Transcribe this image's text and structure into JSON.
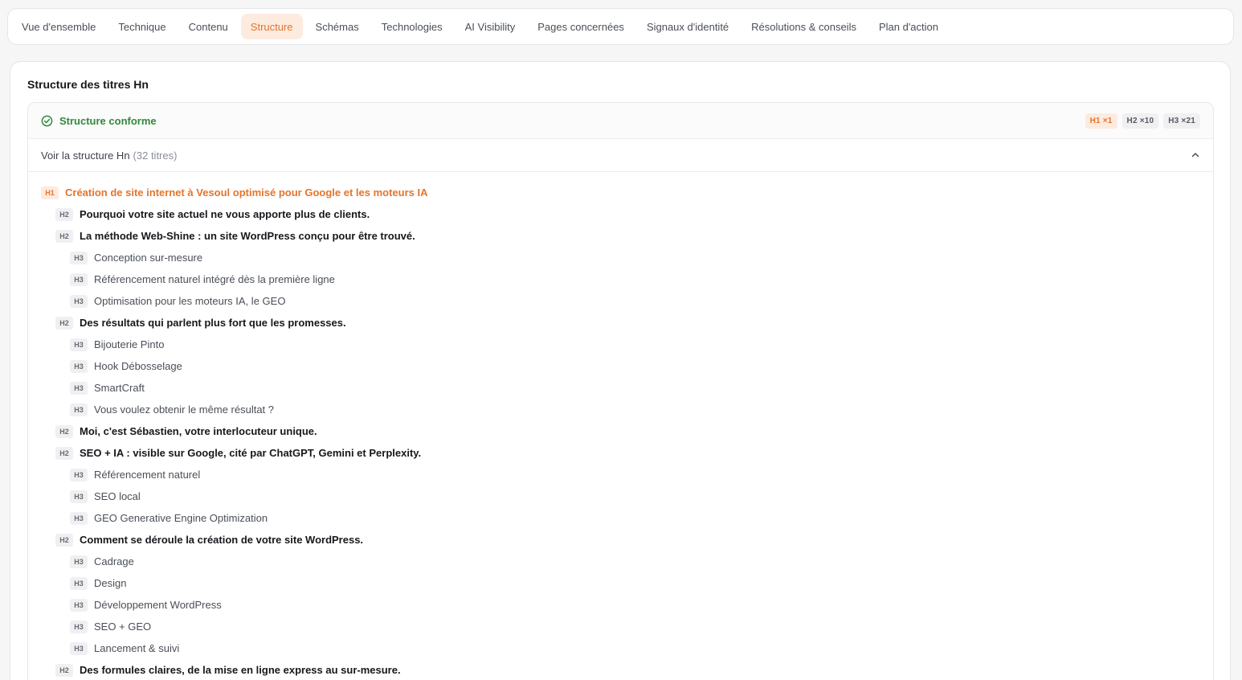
{
  "tabs": [
    {
      "label": "Vue d'ensemble",
      "active": false
    },
    {
      "label": "Technique",
      "active": false
    },
    {
      "label": "Contenu",
      "active": false
    },
    {
      "label": "Structure",
      "active": true
    },
    {
      "label": "Schémas",
      "active": false
    },
    {
      "label": "Technologies",
      "active": false
    },
    {
      "label": "AI Visibility",
      "active": false
    },
    {
      "label": "Pages concernées",
      "active": false
    },
    {
      "label": "Signaux d'identité",
      "active": false
    },
    {
      "label": "Résolutions & conseils",
      "active": false
    },
    {
      "label": "Plan d'action",
      "active": false
    }
  ],
  "card": {
    "title": "Structure des titres Hn",
    "status": {
      "label": "Structure conforme",
      "icon": "check-circle-icon",
      "color": "#2f8a3b"
    },
    "counts": [
      {
        "label": "H1 ×1",
        "level": "h1"
      },
      {
        "label": "H2 ×10",
        "level": "h2"
      },
      {
        "label": "H3 ×21",
        "level": "h3"
      }
    ],
    "toggle": {
      "label": "Voir la structure Hn",
      "count": "(32 titres)",
      "icon": "chevron-up-icon"
    },
    "headings": [
      {
        "level": 1,
        "tag": "H1",
        "text": "Création de site internet à Vesoul optimisé pour Google et les moteurs IA"
      },
      {
        "level": 2,
        "tag": "H2",
        "text": "Pourquoi votre site actuel ne vous apporte plus de clients."
      },
      {
        "level": 2,
        "tag": "H2",
        "text": "La méthode Web-Shine : un site WordPress conçu pour être trouvé."
      },
      {
        "level": 3,
        "tag": "H3",
        "text": "Conception sur-mesure"
      },
      {
        "level": 3,
        "tag": "H3",
        "text": "Référencement naturel intégré dès la première ligne"
      },
      {
        "level": 3,
        "tag": "H3",
        "text": "Optimisation pour les moteurs IA, le GEO"
      },
      {
        "level": 2,
        "tag": "H2",
        "text": "Des résultats qui parlent plus fort que les promesses."
      },
      {
        "level": 3,
        "tag": "H3",
        "text": "Bijouterie Pinto"
      },
      {
        "level": 3,
        "tag": "H3",
        "text": "Hook Débosselage"
      },
      {
        "level": 3,
        "tag": "H3",
        "text": "SmartCraft"
      },
      {
        "level": 3,
        "tag": "H3",
        "text": "Vous voulez obtenir le même résultat ?"
      },
      {
        "level": 2,
        "tag": "H2",
        "text": "Moi, c'est Sébastien, votre interlocuteur unique."
      },
      {
        "level": 2,
        "tag": "H2",
        "text": "SEO + IA : visible sur Google, cité par ChatGPT, Gemini et Perplexity."
      },
      {
        "level": 3,
        "tag": "H3",
        "text": "Référencement naturel"
      },
      {
        "level": 3,
        "tag": "H3",
        "text": "SEO local"
      },
      {
        "level": 3,
        "tag": "H3",
        "text": "GEO Generative Engine Optimization"
      },
      {
        "level": 2,
        "tag": "H2",
        "text": "Comment se déroule la création de votre site WordPress."
      },
      {
        "level": 3,
        "tag": "H3",
        "text": "Cadrage"
      },
      {
        "level": 3,
        "tag": "H3",
        "text": "Design"
      },
      {
        "level": 3,
        "tag": "H3",
        "text": "Développement WordPress"
      },
      {
        "level": 3,
        "tag": "H3",
        "text": "SEO + GEO"
      },
      {
        "level": 3,
        "tag": "H3",
        "text": "Lancement & suivi"
      },
      {
        "level": 2,
        "tag": "H2",
        "text": "Des formules claires, de la mise en ligne express au sur-mesure."
      }
    ]
  }
}
